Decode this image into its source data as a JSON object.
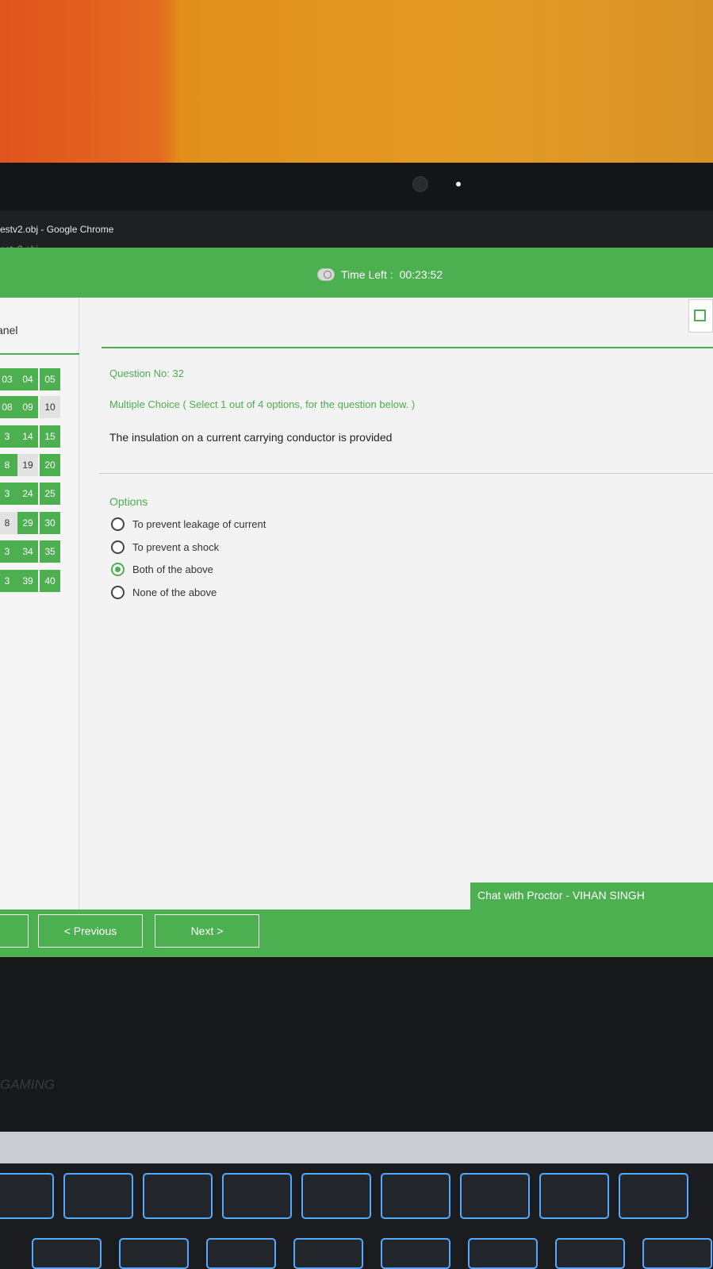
{
  "window": {
    "title": "estv2.obj - Google Chrome",
    "url": "estv2.obj"
  },
  "header": {
    "timer_label": "Time Left :",
    "timer_value": "00:23:52"
  },
  "panel": {
    "title": "anel",
    "questions": [
      {
        "label": "03",
        "answered": true
      },
      {
        "label": "04",
        "answered": true
      },
      {
        "label": "05",
        "answered": true
      },
      {
        "label": "08",
        "answered": true
      },
      {
        "label": "09",
        "answered": true
      },
      {
        "label": "10",
        "answered": false
      },
      {
        "label": "3",
        "answered": true
      },
      {
        "label": "14",
        "answered": true
      },
      {
        "label": "15",
        "answered": true
      },
      {
        "label": "8",
        "answered": true
      },
      {
        "label": "19",
        "answered": false
      },
      {
        "label": "20",
        "answered": true
      },
      {
        "label": "3",
        "answered": true
      },
      {
        "label": "24",
        "answered": true
      },
      {
        "label": "25",
        "answered": true
      },
      {
        "label": "8",
        "answered": false
      },
      {
        "label": "29",
        "answered": true
      },
      {
        "label": "30",
        "answered": true
      },
      {
        "label": "3",
        "answered": true
      },
      {
        "label": "34",
        "answered": true
      },
      {
        "label": "35",
        "answered": true
      },
      {
        "label": "3",
        "answered": true
      },
      {
        "label": "39",
        "answered": true
      },
      {
        "label": "40",
        "answered": true
      }
    ]
  },
  "question": {
    "number_label": "Question No: 32",
    "type_label": "Multiple Choice ( Select 1 out of 4 options, for the question below. )",
    "text": "The insulation on a current carrying conductor is provided",
    "options_heading": "Options",
    "options": [
      {
        "label": "To prevent leakage of current",
        "selected": false
      },
      {
        "label": "To prevent a shock",
        "selected": false
      },
      {
        "label": "Both of the above",
        "selected": true
      },
      {
        "label": "None of the above",
        "selected": false
      }
    ]
  },
  "footer": {
    "chat_label": "Chat with Proctor - VIHAN SINGH",
    "previous_label": "< Previous",
    "next_label": "Next >"
  },
  "laptop": {
    "brand": "GAMING"
  },
  "colors": {
    "accent": "#4caf50",
    "keyboard_glow": "#57a8ff"
  }
}
